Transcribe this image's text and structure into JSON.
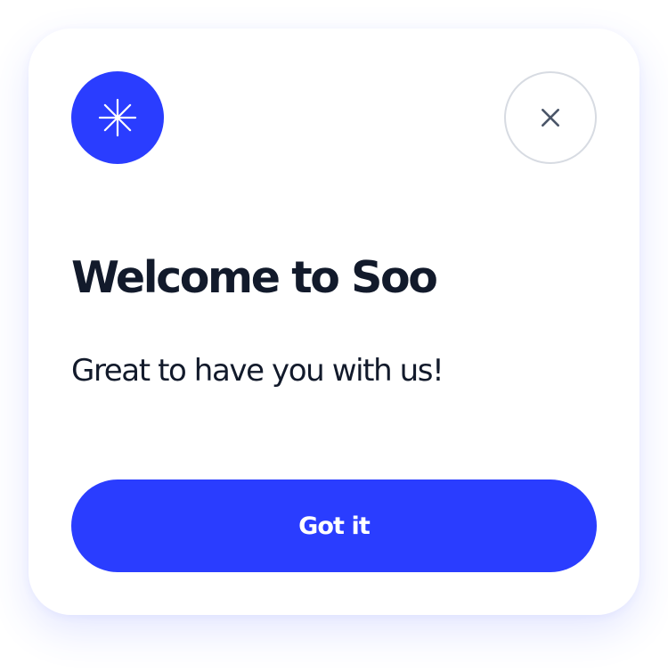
{
  "dialog": {
    "brand_icon": "sparkle-asterisk-icon",
    "close_icon": "close-icon",
    "title": "Welcome to Soo",
    "message": "Great to have you with us!",
    "primary_button_label": "Got it"
  },
  "colors": {
    "accent": "#2a3dff",
    "title_text": "#121a2b",
    "close_border": "#d7dbe2",
    "close_icon": "#4a5568",
    "background": "#ffffff"
  }
}
